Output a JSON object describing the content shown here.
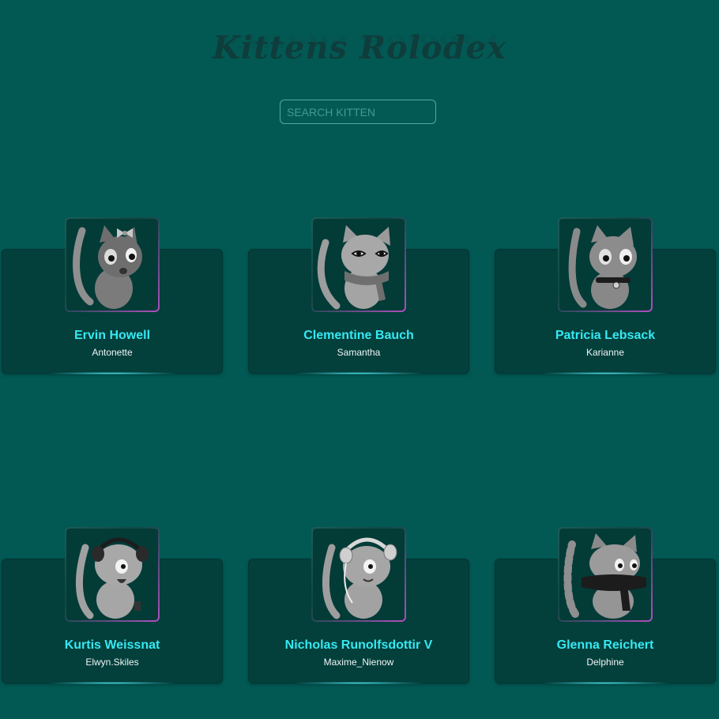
{
  "app": {
    "title": "Kittens Rolodex"
  },
  "search": {
    "placeholder": "SEARCH KITTEN"
  },
  "kittens": [
    {
      "name": "Ervin Howell",
      "username": "Antonette",
      "accessory": "bow"
    },
    {
      "name": "Clementine Bauch",
      "username": "Samantha",
      "accessory": "scarf"
    },
    {
      "name": "Patricia Lebsack",
      "username": "Karianne",
      "accessory": "collar-bell"
    },
    {
      "name": "Kurtis Weissnat",
      "username": "Elwyn.Skiles",
      "accessory": "headphones-dark"
    },
    {
      "name": "Nicholas Runolfsdottir V",
      "username": "Maxime_Nienow",
      "accessory": "headphones-light"
    },
    {
      "name": "Glenna Reichert",
      "username": "Delphine",
      "accessory": "black-scarf"
    }
  ]
}
